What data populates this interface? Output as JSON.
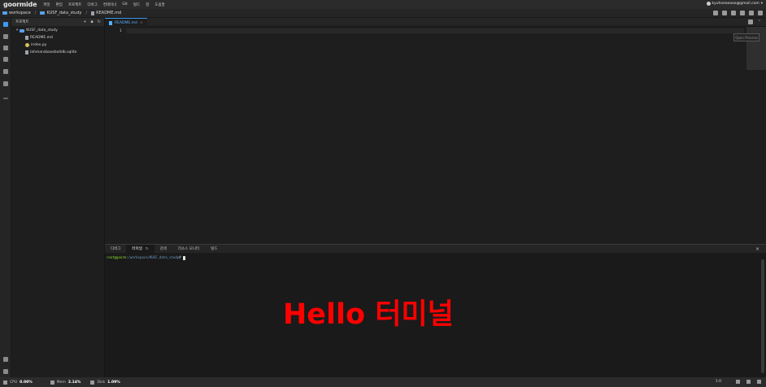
{
  "app": {
    "logo": "goormide"
  },
  "menubar": {
    "items": [
      "파일",
      "편집",
      "프로젝트",
      "디버그",
      "컨테이너",
      "Git",
      "빌드",
      "창",
      "도움말"
    ],
    "account": "kyuhoeaeaaa@gmail.com"
  },
  "breadcrumb": {
    "items": [
      "workspace",
      "KUSF_data_study",
      "README.md"
    ],
    "separator": "/"
  },
  "sidebar": {
    "title": "프로젝트",
    "tree": [
      {
        "label": "KUSF_data_study",
        "kind": "folder"
      },
      {
        "label": "README.md",
        "kind": "file"
      },
      {
        "label": "index.py",
        "kind": "python"
      },
      {
        "label": "lahmansbaseballdb.sqlite",
        "kind": "file"
      }
    ]
  },
  "editor": {
    "tab_label": "README.md",
    "line_number": "1",
    "preview_button": "Open Preview"
  },
  "panel": {
    "tabs": [
      "디버그",
      "터미널",
      "검색",
      "리소스 모니터",
      "빌드"
    ],
    "active_tab": "터미널",
    "close": "×"
  },
  "terminal": {
    "prompt_user": "root@goorm",
    "prompt_sep": ":",
    "prompt_path": "/workspace/KUSF_data_study",
    "prompt_symbol": "#",
    "overlay_text": "Hello 터미널"
  },
  "statusbar": {
    "cpu_label": "CPU",
    "cpu_value": "0.00%",
    "mem_label": "Mem",
    "mem_value": "2.14%",
    "disk_label": "Disk",
    "disk_value": "1.09%",
    "position": "1:0"
  },
  "colors": {
    "accent": "#3d9bf0",
    "overlay_text": "#ff0000",
    "prompt_user": "#8ae234",
    "prompt_path": "#729fcf"
  }
}
